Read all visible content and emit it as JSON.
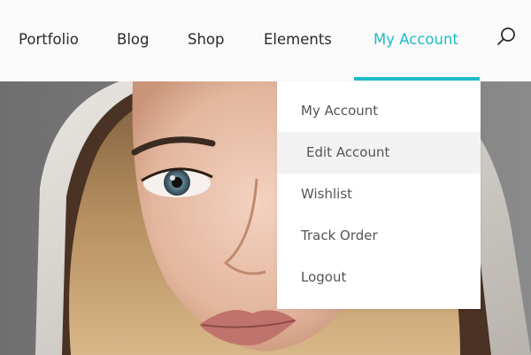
{
  "nav": {
    "items": [
      {
        "label": "Portfolio"
      },
      {
        "label": "Blog"
      },
      {
        "label": "Shop"
      },
      {
        "label": "Elements"
      },
      {
        "label": "My Account",
        "active": true
      }
    ],
    "search_icon": "search-icon"
  },
  "dropdown": {
    "items": [
      {
        "label": "My Account"
      },
      {
        "label": "Edit Account",
        "hovered": true
      },
      {
        "label": "Wishlist"
      },
      {
        "label": "Track Order"
      },
      {
        "label": "Logout"
      }
    ]
  },
  "colors": {
    "accent": "#1fbcc8",
    "nav_text": "#2b2b2b",
    "dropdown_text": "#555555",
    "hover_bg": "#f2f2f2",
    "navbar_bg": "#fafafa"
  }
}
